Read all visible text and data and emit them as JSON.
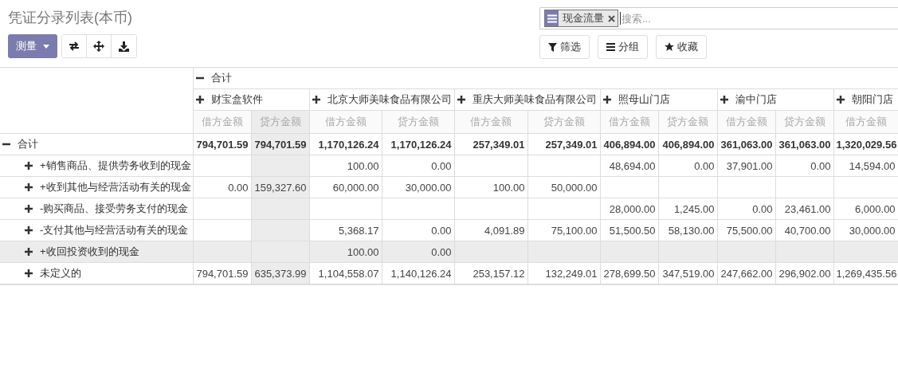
{
  "title": "凭证分录列表(本币)",
  "measure_button": {
    "label": "测量"
  },
  "search": {
    "facets": [
      {
        "label": "现金流量"
      }
    ],
    "placeholder": "搜索..."
  },
  "filter_buttons": [
    {
      "label": "筛选",
      "kind": "filter"
    },
    {
      "label": "分组",
      "kind": "group"
    },
    {
      "label": "收藏",
      "kind": "favorite"
    }
  ],
  "pivot": {
    "column_total": {
      "label": "合计",
      "expanded": true,
      "children": [
        {
          "label": "财宝盒软件",
          "expanded": false,
          "measures": [
            {
              "label": "借方金额",
              "highlighted": false
            },
            {
              "label": "贷方金额",
              "highlighted": true
            }
          ]
        },
        {
          "label": "北京大师美味食品有限公司",
          "expanded": false,
          "measures": [
            {
              "label": "借方金额",
              "highlighted": false
            },
            {
              "label": "贷方金额",
              "highlighted": false
            }
          ]
        },
        {
          "label": "重庆大师美味食品有限公司",
          "expanded": false,
          "measures": [
            {
              "label": "借方金额",
              "highlighted": false
            },
            {
              "label": "贷方金额",
              "highlighted": false
            }
          ]
        },
        {
          "label": "照母山门店",
          "expanded": false,
          "measures": [
            {
              "label": "借方金额",
              "highlighted": false
            },
            {
              "label": "贷方金额",
              "highlighted": false
            }
          ]
        },
        {
          "label": "渝中门店",
          "expanded": false,
          "measures": [
            {
              "label": "借方金额",
              "highlighted": false
            },
            {
              "label": "贷方金额",
              "highlighted": false
            }
          ]
        },
        {
          "label": "朝阳门店",
          "expanded": false,
          "measures": [
            {
              "label": "借方金额",
              "highlighted": false
            }
          ]
        }
      ]
    },
    "row_total": {
      "label": "合计",
      "expanded": true,
      "cells": [
        {
          "value": "794,701.59"
        },
        {
          "value": "794,701.59"
        },
        {
          "value": "1,170,126.24"
        },
        {
          "value": "1,170,126.24"
        },
        {
          "value": "257,349.01"
        },
        {
          "value": "257,349.01"
        },
        {
          "value": "406,894.00"
        },
        {
          "value": "406,894.00"
        },
        {
          "value": "361,063.00"
        },
        {
          "value": "361,063.00"
        },
        {
          "value": "1,320,029.56"
        }
      ],
      "children": [
        {
          "label": "+销售商品、提供劳务收到的现金",
          "expanded": false,
          "highlighted": false,
          "cells": [
            {},
            {},
            {
              "value": "100.00"
            },
            {
              "value": "0.00"
            },
            {},
            {},
            {
              "value": "48,694.00"
            },
            {
              "value": "0.00"
            },
            {
              "value": "37,901.00"
            },
            {
              "value": "0.00"
            },
            {
              "value": "14,594.00"
            }
          ]
        },
        {
          "label": "+收到其他与经营活动有关的现金",
          "expanded": false,
          "highlighted": false,
          "cells": [
            {
              "value": "0.00"
            },
            {
              "value": "159,327.60"
            },
            {
              "value": "60,000.00"
            },
            {
              "value": "30,000.00"
            },
            {
              "value": "100.00"
            },
            {
              "value": "50,000.00"
            },
            {},
            {},
            {},
            {},
            {}
          ]
        },
        {
          "label": "-购买商品、接受劳务支付的现金",
          "expanded": false,
          "highlighted": false,
          "cells": [
            {},
            {},
            {},
            {},
            {},
            {},
            {
              "value": "28,000.00"
            },
            {
              "value": "1,245.00"
            },
            {
              "value": "0.00"
            },
            {
              "value": "23,461.00"
            },
            {
              "value": "6,000.00"
            }
          ]
        },
        {
          "label": "-支付其他与经营活动有关的现金",
          "expanded": false,
          "highlighted": false,
          "cells": [
            {},
            {},
            {
              "value": "5,368.17"
            },
            {
              "value": "0.00"
            },
            {
              "value": "4,091.89"
            },
            {
              "value": "75,100.00"
            },
            {
              "value": "51,500.50"
            },
            {
              "value": "58,130.00"
            },
            {
              "value": "75,500.00"
            },
            {
              "value": "40,700.00"
            },
            {
              "value": "30,000.00"
            }
          ]
        },
        {
          "label": "+收回投资收到的现金",
          "expanded": false,
          "highlighted": true,
          "cells": [
            {},
            {},
            {
              "value": "100.00"
            },
            {
              "value": "0.00"
            },
            {},
            {},
            {},
            {},
            {},
            {},
            {}
          ]
        },
        {
          "label": "未定义的",
          "expanded": false,
          "highlighted": false,
          "cells": [
            {
              "value": "794,701.59"
            },
            {
              "value": "635,373.99"
            },
            {
              "value": "1,104,558.07"
            },
            {
              "value": "1,140,126.24"
            },
            {
              "value": "253,157.12"
            },
            {
              "value": "132,249.01"
            },
            {
              "value": "278,699.50"
            },
            {
              "value": "347,519.00"
            },
            {
              "value": "247,662.00"
            },
            {
              "value": "296,902.00"
            },
            {
              "value": "1,269,435.56"
            }
          ]
        }
      ]
    }
  }
}
